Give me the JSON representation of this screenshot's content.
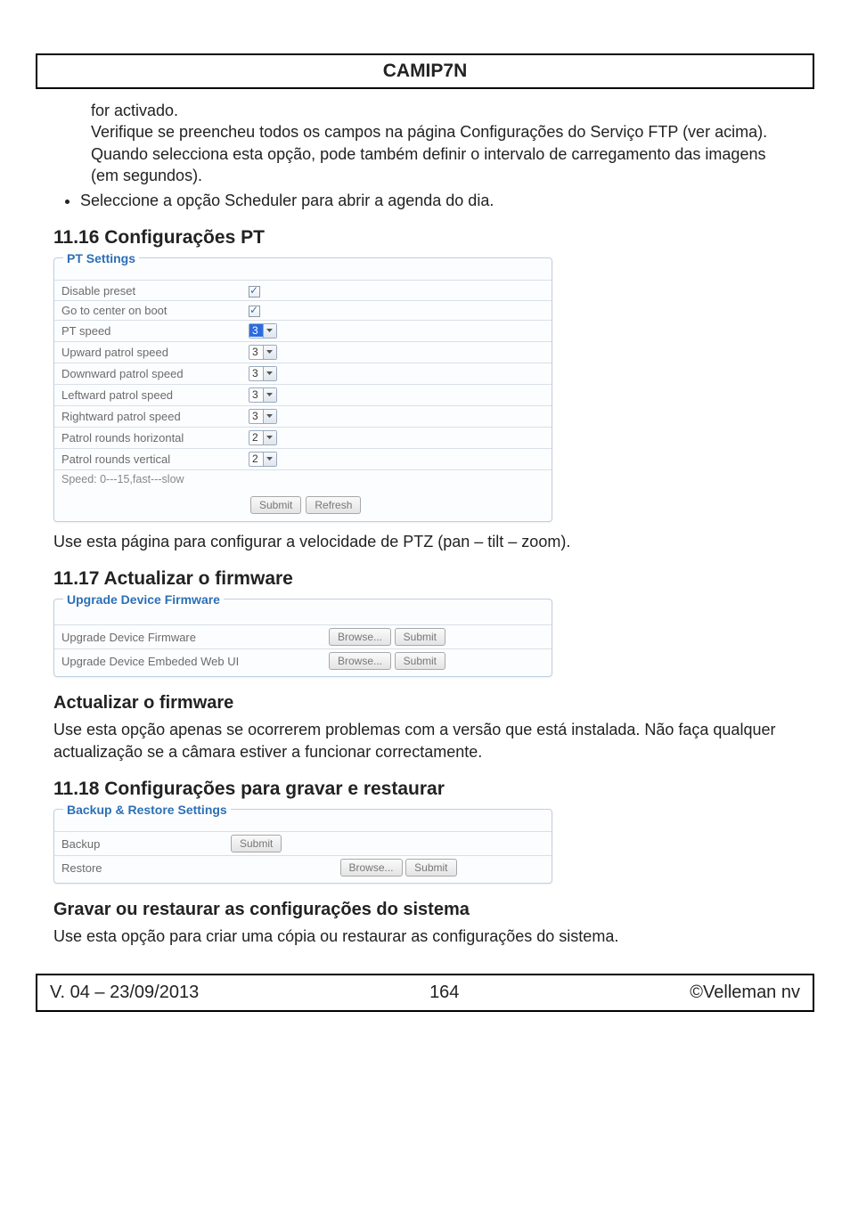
{
  "header": {
    "title": "CAMIP7N"
  },
  "intro": {
    "continued": "for activado.",
    "continued2": "Verifique se preencheu todos os campos na página Configurações do Serviço FTP (ver acima). Quando selecciona esta opção, pode também definir o intervalo de carregamento das imagens (em segundos).",
    "bullet1": "Seleccione a opção Scheduler para abrir a agenda do dia."
  },
  "pt": {
    "heading": "11.16 Configurações PT",
    "legend": "PT Settings",
    "rows": {
      "disable_preset": "Disable preset",
      "go_center": "Go to center on boot",
      "pt_speed": "PT speed",
      "up_speed": "Upward patrol speed",
      "down_speed": "Downward patrol speed",
      "left_speed": "Leftward patrol speed",
      "right_speed": "Rightward patrol speed",
      "rounds_h": "Patrol rounds horizontal",
      "rounds_v": "Patrol rounds vertical",
      "footnote": "Speed: 0---15,fast---slow"
    },
    "values": {
      "pt_speed": "3",
      "up_speed": "3",
      "down_speed": "3",
      "left_speed": "3",
      "right_speed": "3",
      "rounds_h": "2",
      "rounds_v": "2"
    },
    "buttons": {
      "submit": "Submit",
      "refresh": "Refresh"
    },
    "after": "Use esta página para configurar a velocidade de PTZ (pan – tilt – zoom)."
  },
  "fw": {
    "heading": "11.17 Actualizar o firmware",
    "legend": "Upgrade Device Firmware",
    "row1": "Upgrade Device Firmware",
    "row2": "Upgrade Device Embeded Web UI",
    "browse": "Browse...",
    "submit": "Submit",
    "sub_heading": "Actualizar o firmware",
    "after": "Use esta opção apenas se ocorrerem problemas com a versão que está instalada. Não faça qualquer actualização se a câmara estiver a funcionar correctamente."
  },
  "br": {
    "heading": "11.18 Configurações para gravar e restaurar",
    "legend": "Backup & Restore Settings",
    "row1": "Backup",
    "row2": "Restore",
    "browse": "Browse...",
    "submit": "Submit",
    "sub_heading": "Gravar ou restaurar as configurações do sistema",
    "after": "Use esta opção para criar uma cópia ou restaurar as configurações do sistema."
  },
  "footer": {
    "version": "V. 04 – 23/09/2013",
    "page": "164",
    "copyright": "©Velleman nv"
  }
}
